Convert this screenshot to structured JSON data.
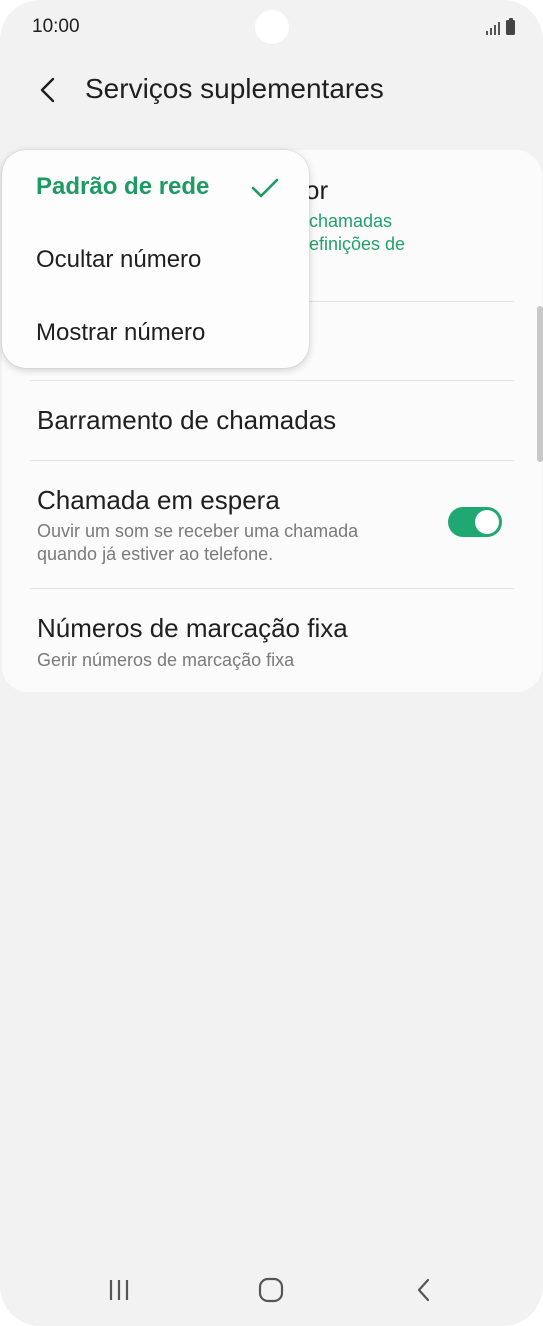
{
  "status_bar": {
    "time": "10:00",
    "icons": [
      "signal-icon",
      "battery-icon"
    ]
  },
  "header": {
    "title": "Serviços suplementares",
    "back_icon": "chevron-left-icon"
  },
  "settings": {
    "caller_id": {
      "title_fragment": "or",
      "subtitle_line1_fragment": "chamadas",
      "subtitle_line2_fragment": "efinições de"
    },
    "call_barring": {
      "title": "Barramento de chamadas"
    },
    "call_waiting": {
      "title": "Chamada em espera",
      "subtitle_line1": "Ouvir um som se receber uma chamada",
      "subtitle_line2": "quando já estiver ao telefone.",
      "enabled": true
    },
    "fixed_dialing": {
      "title": "Números de marcação fixa",
      "subtitle": "Gerir números de marcação fixa"
    }
  },
  "popup_menu": {
    "options": [
      {
        "label": "Padrão de rede",
        "selected": true
      },
      {
        "label": "Ocultar número",
        "selected": false
      },
      {
        "label": "Mostrar número",
        "selected": false
      }
    ],
    "check_icon": "check-icon"
  },
  "nav_bar": {
    "icons": [
      "recent-apps-icon",
      "home-icon",
      "back-icon"
    ]
  },
  "colors": {
    "accent": "#1e9a63",
    "toggle_on": "#1fa872",
    "background": "#f2f2f2",
    "card": "#fbfbfb"
  }
}
